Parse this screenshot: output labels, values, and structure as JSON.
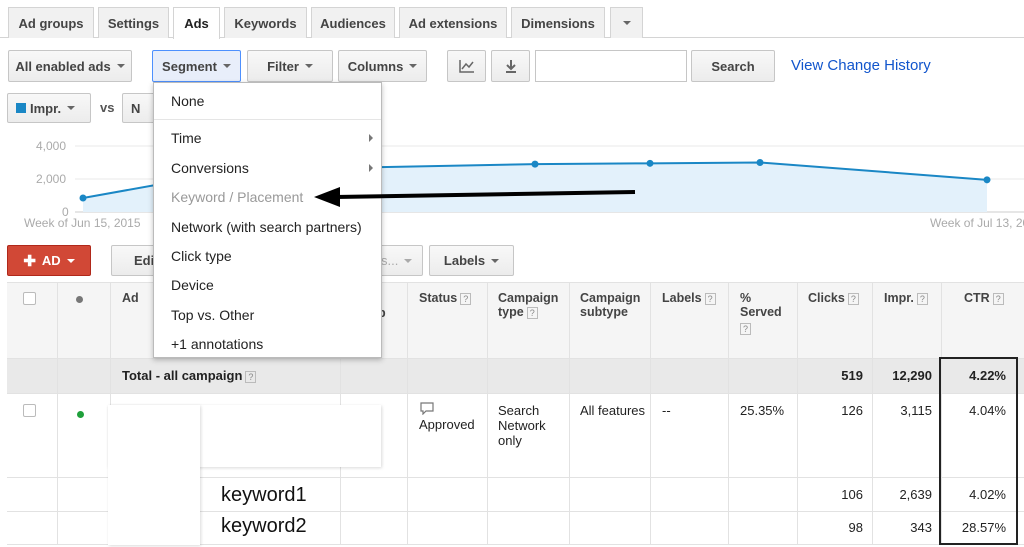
{
  "tabs": [
    "Ad groups",
    "Settings",
    "Ads",
    "Keywords",
    "Audiences",
    "Ad extensions",
    "Dimensions"
  ],
  "toolbar": {
    "all_enabled_ads": "All enabled ads",
    "segment": "Segment",
    "filter": "Filter",
    "columns": "Columns",
    "search_label": "Search",
    "search_value": "",
    "view_change_history": "View Change History"
  },
  "chart_controls": {
    "metric1": "Impr.",
    "vs": "vs",
    "metric2": "N",
    "metric1_color": "#1a87c5"
  },
  "chart_data": {
    "type": "area",
    "x": [
      "Week of Jun 15, 2015",
      "",
      "",
      "",
      "",
      "Week of Jul 13, 2015"
    ],
    "y_ticks": [
      "4,000",
      "2,000",
      "0"
    ],
    "ylim": [
      0,
      4000
    ],
    "values": [
      850,
      2550,
      2900,
      2950,
      3000,
      1950
    ],
    "x_start_label": "Week of Jun 15, 2015",
    "x_end_label": "Week of Jul 13, 20",
    "series_color": "#1a87c5"
  },
  "action_bar": {
    "add_ad": "AD",
    "edit": "Edi",
    "hidden_dropdown": "s...",
    "labels": "Labels"
  },
  "table": {
    "headers": {
      "ad": "Ad",
      "hidden_col": "p",
      "status": "Status",
      "campaign_type": "Campaign type",
      "campaign_subtype": "Campaign subtype",
      "labels": "Labels",
      "served": "% Served",
      "clicks": "Clicks",
      "impr": "Impr.",
      "ctr": "CTR"
    },
    "total": {
      "label": "Total - all campaign",
      "clicks": "519",
      "impr": "12,290",
      "ctr": "4.22%"
    },
    "row1": {
      "status": "Approved",
      "campaign_type": "Search Network only",
      "campaign_subtype": "All features",
      "labels": "--",
      "served": "25.35%",
      "clicks": "126",
      "impr": "3,115",
      "ctr": "4.04%"
    },
    "row2": {
      "keyword": "keyword1",
      "clicks": "106",
      "impr": "2,639",
      "ctr": "4.02%"
    },
    "row3": {
      "keyword": "keyword2",
      "clicks": "98",
      "impr": "343",
      "ctr": "28.57%"
    }
  },
  "segment_menu": {
    "items": [
      "None",
      "Time",
      "Conversions",
      "Keyword / Placement",
      "Network (with search partners)",
      "Click type",
      "Device",
      "Top vs. Other",
      "+1 annotations"
    ]
  }
}
